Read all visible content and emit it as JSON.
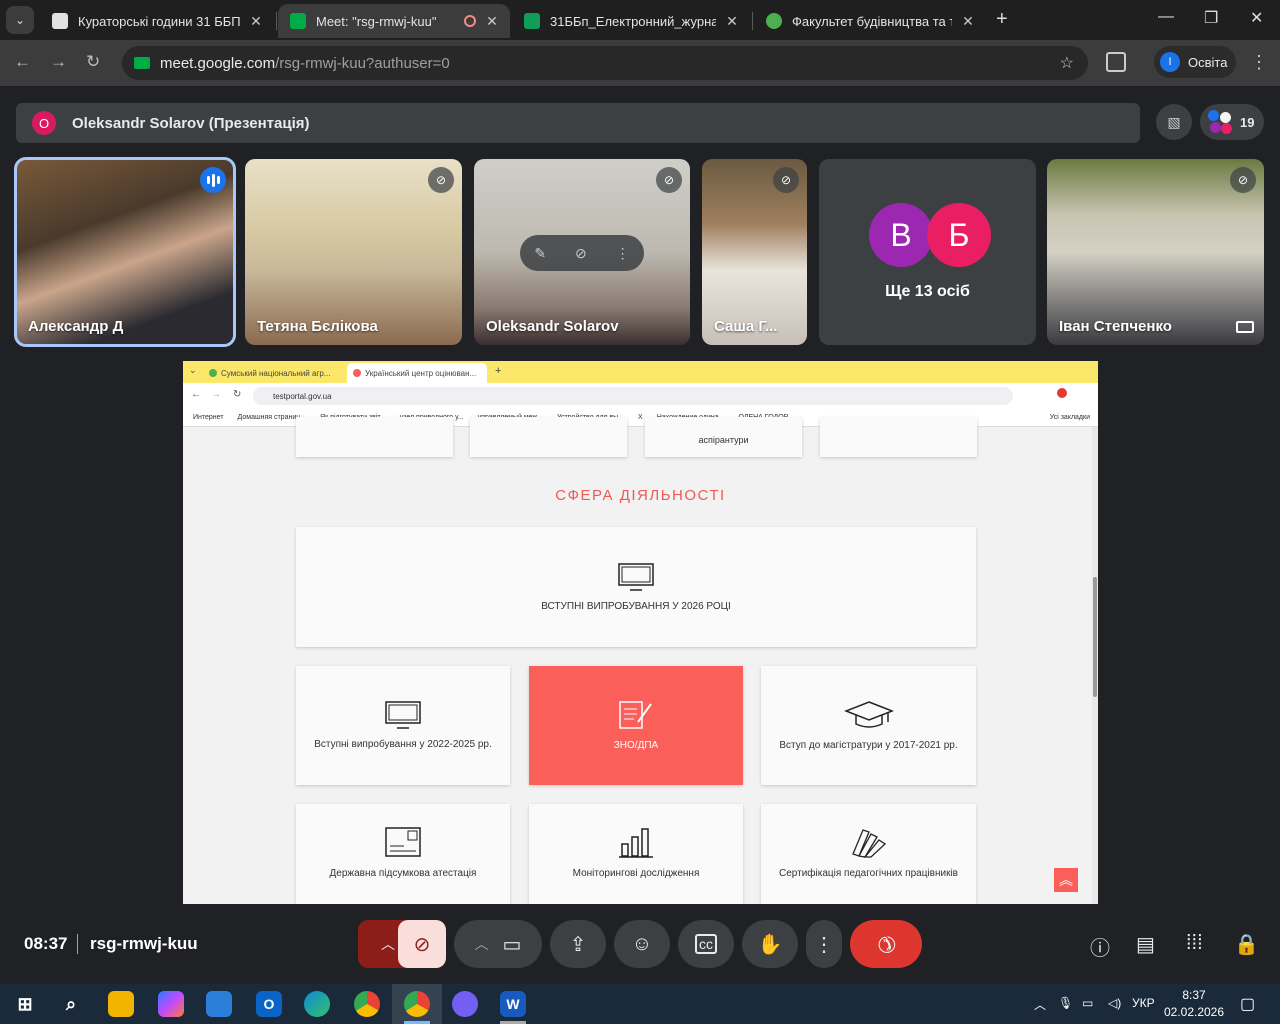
{
  "browser": {
    "tabs": [
      {
        "title": "Кураторські години 31 ББП",
        "favicon_color": "#e0e0e0"
      },
      {
        "title": "Meet: \"rsg-rmwj-kuu\"",
        "favicon_color": "#00ac47",
        "active": true
      },
      {
        "title": "31ББп_Електронний_журнал_2",
        "favicon_color": "#0f9d58"
      },
      {
        "title": "Факультет будівництва та тран",
        "favicon_color": "#4caf50"
      }
    ],
    "url_host": "meet.google.com",
    "url_path": "/rsg-rmwj-kuu?authuser=0",
    "profile_initial": "I",
    "profile_name": "Освіта"
  },
  "meet": {
    "presenter": {
      "initial": "O",
      "name": "Oleksandr Solarov (Презентація)"
    },
    "participant_count": "19",
    "participants": [
      {
        "name": "Александр Д",
        "speaking": true
      },
      {
        "name": "Тетяна Бєлікова",
        "muted": true
      },
      {
        "name": "Oleksandr Solarov",
        "muted": true
      },
      {
        "name": "Саша Г...",
        "muted": true
      },
      {
        "avatars": [
          "В",
          "Б"
        ],
        "label": "Ще 13 осіб"
      },
      {
        "name": "Іван Степченко",
        "muted": true
      }
    ],
    "time": "08:37",
    "meeting_code": "rsg-rmwj-kuu"
  },
  "shared_screen": {
    "tabs": [
      "Сумський національний агр...",
      "Український центр оцінюван..."
    ],
    "url": "testportal.gov.ua",
    "bookmarks": [
      "Интернет",
      "Домашняя страниц...",
      "Як підготувати звіт...",
      "узел приводного у...",
      "управляемый меж...",
      "Устройство для вы...",
      "Х",
      "Нахождение одина...",
      "ОЛЕНА ГОДОР"
    ],
    "bookmarks_all": "Усі закладки",
    "top_card_text": "аспірантури",
    "section_title": "СФЕРА ДІЯЛЬНОСТІ",
    "cards": [
      {
        "label": "ВСТУПНІ ВИПРОБУВАННЯ У 2026 РОЦІ",
        "icon": "monitor-icon"
      },
      {
        "label": "Вступні випробування у 2022-2025 рр.",
        "icon": "monitor-icon"
      },
      {
        "label": "ЗНО/ДПА",
        "icon": "document-pen-icon",
        "highlight": true
      },
      {
        "label": "Вступ до магістратури у 2017-2021 рр.",
        "icon": "graduation-cap-icon"
      },
      {
        "label": "Державна підсумкова атестація",
        "icon": "certificate-icon"
      },
      {
        "label": "Моніторингові дослідження",
        "icon": "bar-chart-icon"
      },
      {
        "label": "Сертифікація педагогічних працівників",
        "icon": "swatches-icon"
      }
    ],
    "accent_color": "#fa5f5a"
  },
  "taskbar": {
    "language": "УКР",
    "time": "8:37",
    "date": "02.02.2026"
  }
}
